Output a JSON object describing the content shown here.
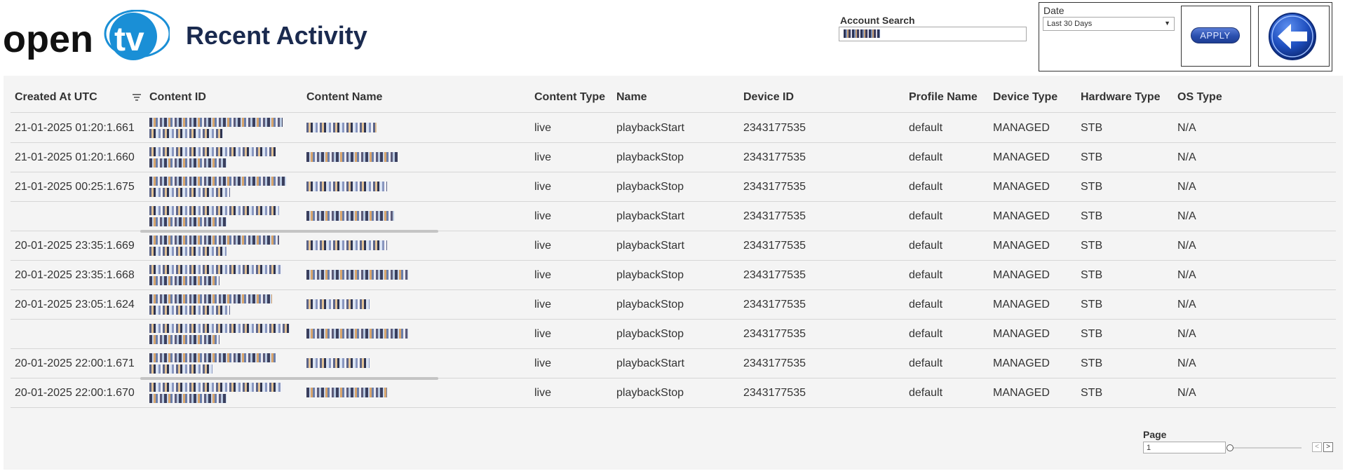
{
  "header": {
    "logo_text_left": "open",
    "logo_text_right": "tv",
    "title": "Recent Activity"
  },
  "search": {
    "label": "Account Search",
    "value": ""
  },
  "filters": {
    "date_label": "Date",
    "date_selected": "Last 30 Days",
    "apply_label": "APPLY"
  },
  "icons": {
    "back": "arrow-left-icon",
    "sort": "sort-icon",
    "dropdown": "chevron-down-icon"
  },
  "colors": {
    "brand_blue": "#1a8fd6",
    "title_navy": "#1a2a4f",
    "button_blue": "#2a4fae",
    "panel_bg": "#f4f4f4"
  },
  "table": {
    "columns": [
      "Created At UTC",
      "Content ID",
      "Content Name",
      "Content Type",
      "Name",
      "Device ID",
      "Profile Name",
      "Device Type",
      "Hardware Type",
      "OS Type"
    ],
    "rows": [
      {
        "created": "21-01-2025 01:20:1.661",
        "content_type": "live",
        "name": "playbackStart",
        "device_id": "2343177535",
        "profile": "default",
        "device_type": "MANAGED",
        "hardware_type": "STB",
        "os_type": "N/A"
      },
      {
        "created": "21-01-2025 01:20:1.660",
        "content_type": "live",
        "name": "playbackStop",
        "device_id": "2343177535",
        "profile": "default",
        "device_type": "MANAGED",
        "hardware_type": "STB",
        "os_type": "N/A"
      },
      {
        "created": "21-01-2025 00:25:1.675",
        "content_type": "live",
        "name": "playbackStop",
        "device_id": "2343177535",
        "profile": "default",
        "device_type": "MANAGED",
        "hardware_type": "STB",
        "os_type": "N/A"
      },
      {
        "created": "",
        "content_type": "live",
        "name": "playbackStart",
        "device_id": "2343177535",
        "profile": "default",
        "device_type": "MANAGED",
        "hardware_type": "STB",
        "os_type": "N/A"
      },
      {
        "created": "20-01-2025 23:35:1.669",
        "content_type": "live",
        "name": "playbackStart",
        "device_id": "2343177535",
        "profile": "default",
        "device_type": "MANAGED",
        "hardware_type": "STB",
        "os_type": "N/A"
      },
      {
        "created": "20-01-2025 23:35:1.668",
        "content_type": "live",
        "name": "playbackStop",
        "device_id": "2343177535",
        "profile": "default",
        "device_type": "MANAGED",
        "hardware_type": "STB",
        "os_type": "N/A"
      },
      {
        "created": "20-01-2025 23:05:1.624",
        "content_type": "live",
        "name": "playbackStop",
        "device_id": "2343177535",
        "profile": "default",
        "device_type": "MANAGED",
        "hardware_type": "STB",
        "os_type": "N/A"
      },
      {
        "created": "",
        "content_type": "live",
        "name": "playbackStop",
        "device_id": "2343177535",
        "profile": "default",
        "device_type": "MANAGED",
        "hardware_type": "STB",
        "os_type": "N/A"
      },
      {
        "created": "20-01-2025 22:00:1.671",
        "content_type": "live",
        "name": "playbackStart",
        "device_id": "2343177535",
        "profile": "default",
        "device_type": "MANAGED",
        "hardware_type": "STB",
        "os_type": "N/A"
      },
      {
        "created": "20-01-2025 22:00:1.670",
        "content_type": "live",
        "name": "playbackStop",
        "device_id": "2343177535",
        "profile": "default",
        "device_type": "MANAGED",
        "hardware_type": "STB",
        "os_type": "N/A"
      }
    ]
  },
  "pager": {
    "label": "Page",
    "value": "1",
    "prev_symbol": "<",
    "next_symbol": ">"
  }
}
